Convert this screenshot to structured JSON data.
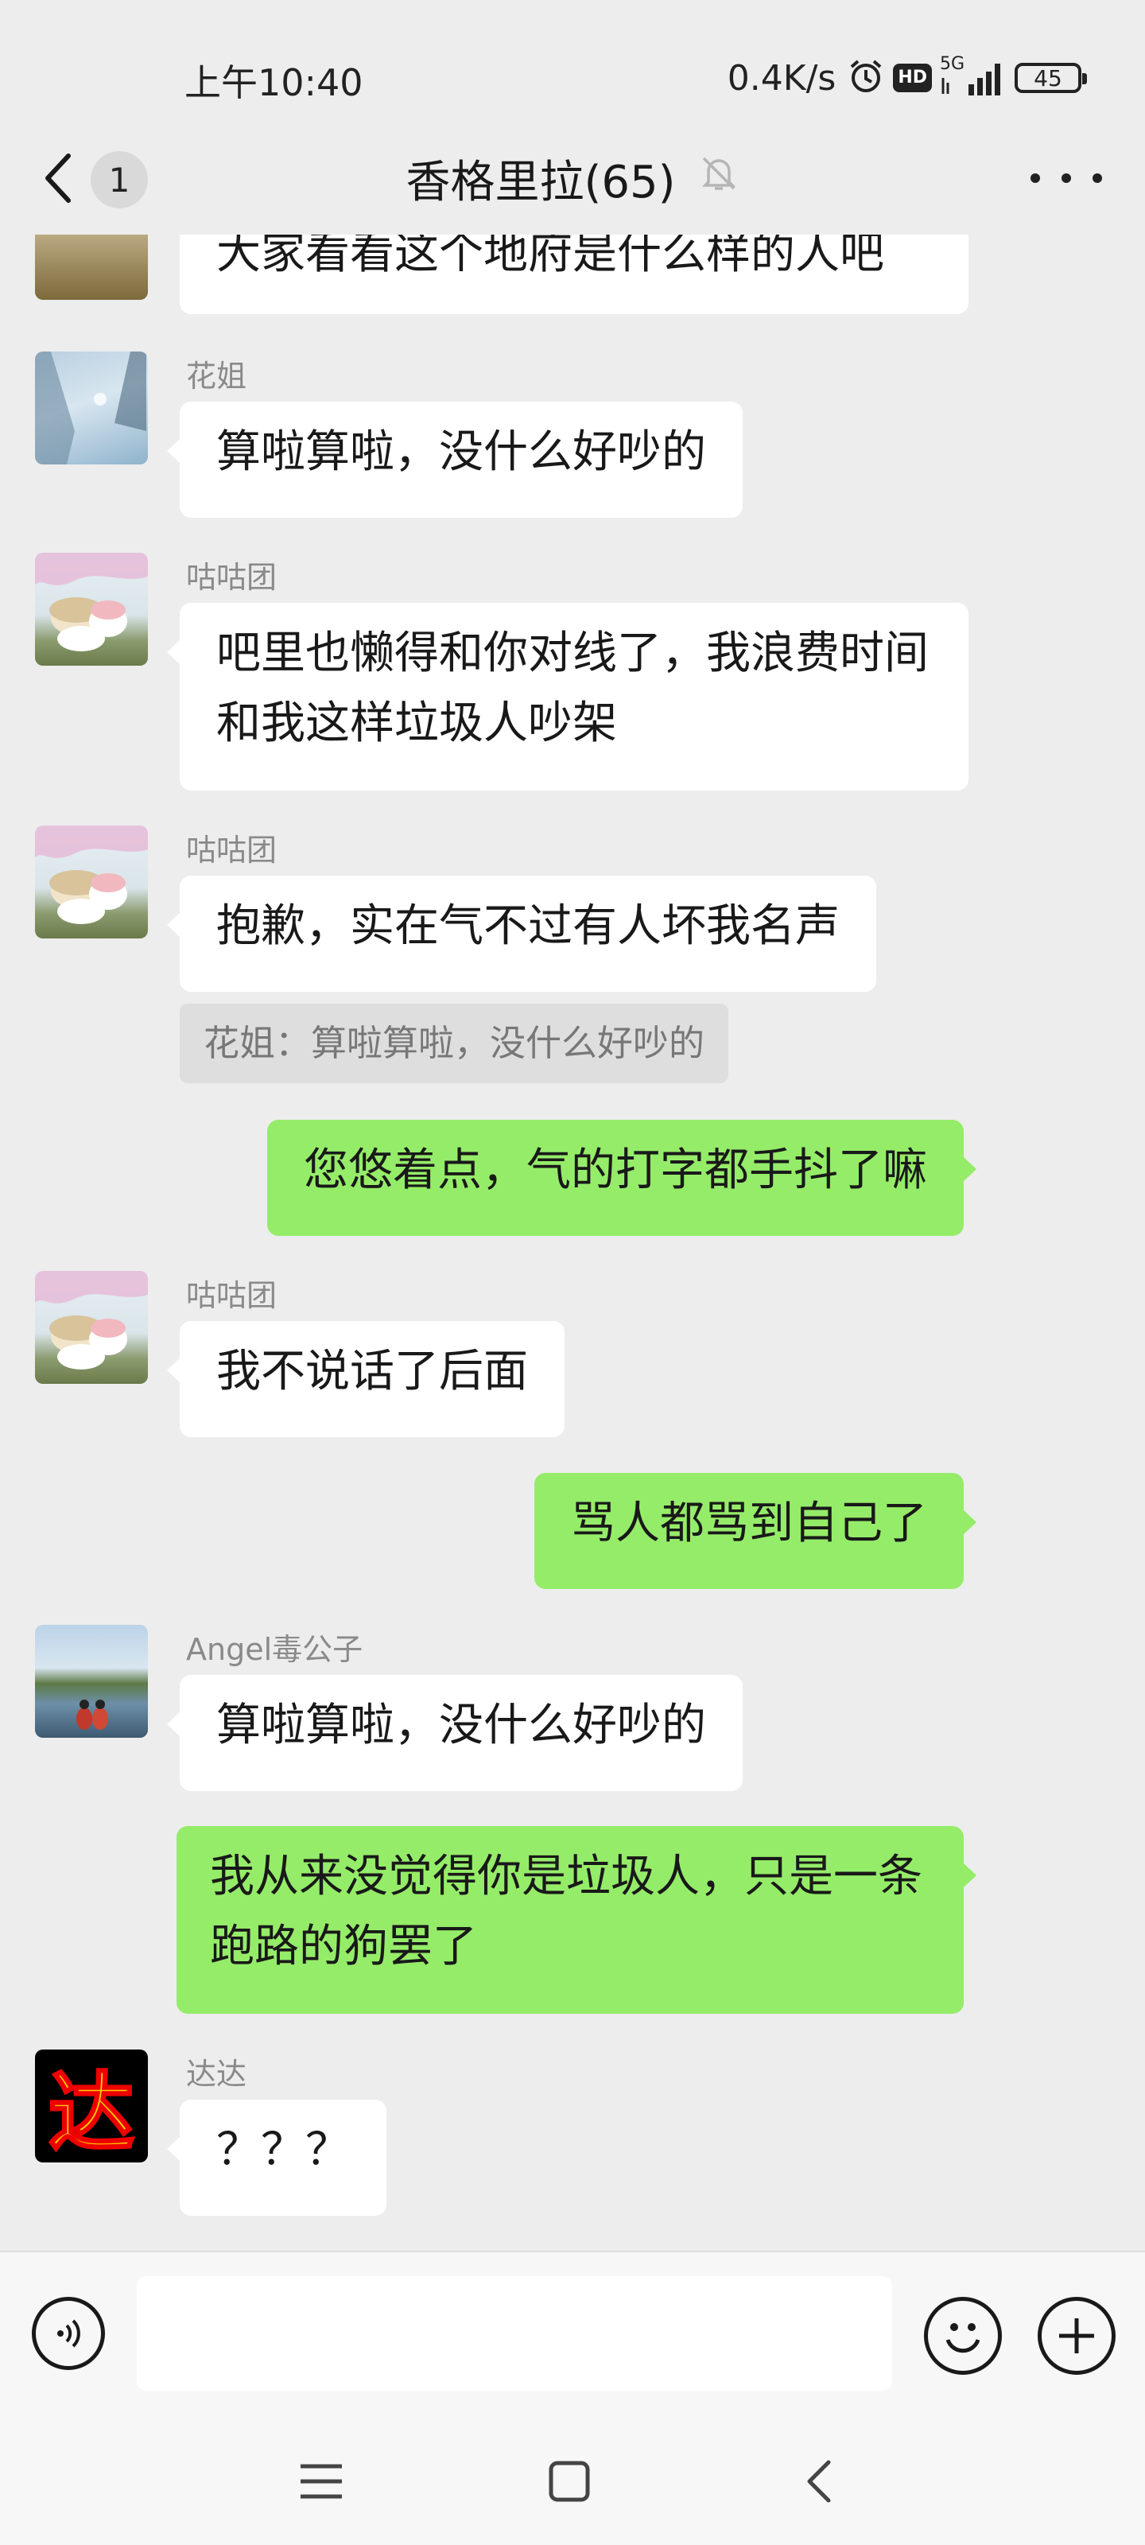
{
  "status_bar": {
    "time": "上午10:40",
    "net_speed": "0.4K/s",
    "hd_label": "HD",
    "network_label": "5G",
    "battery": "45"
  },
  "header": {
    "unread_count": "1",
    "title": "香格里拉(65)"
  },
  "messages": [
    {
      "type": "incoming",
      "text": "大家看看这个地府是什么样的人吧"
    },
    {
      "type": "incoming",
      "sender": "花姐",
      "text": "算啦算啦，没什么好吵的"
    },
    {
      "type": "incoming",
      "sender": "咕咕团",
      "text": "吧里也懒得和你对线了，我浪费时间和我这样垃圾人吵架"
    },
    {
      "type": "incoming",
      "sender": "咕咕团",
      "text": "抱歉，实在气不过有人坏我名声",
      "quote": "花姐：算啦算啦，没什么好吵的"
    },
    {
      "type": "outgoing",
      "text": "您悠着点，气的打字都手抖了嘛"
    },
    {
      "type": "incoming",
      "sender": "咕咕团",
      "text": "我不说话了后面"
    },
    {
      "type": "outgoing",
      "text": "骂人都骂到自己了"
    },
    {
      "type": "incoming",
      "sender": "Angel毒公子",
      "text": "算啦算啦，没什么好吵的"
    },
    {
      "type": "outgoing",
      "text": "我从来没觉得你是垃圾人，只是一条跑路的狗罢了"
    },
    {
      "type": "incoming",
      "sender": "达达",
      "text": "？？？",
      "avatar_char": "达"
    }
  ],
  "input": {
    "value": ""
  },
  "colors": {
    "outgoing_bubble": "#95ec69",
    "incoming_bubble": "#ffffff",
    "background": "#ededed"
  },
  "icons": [
    "back-chevron-icon",
    "mute-bell-icon",
    "more-dots-icon",
    "voice-icon",
    "emoji-icon",
    "add-icon",
    "menu-icon",
    "home-square-icon",
    "back-triangle-icon"
  ]
}
